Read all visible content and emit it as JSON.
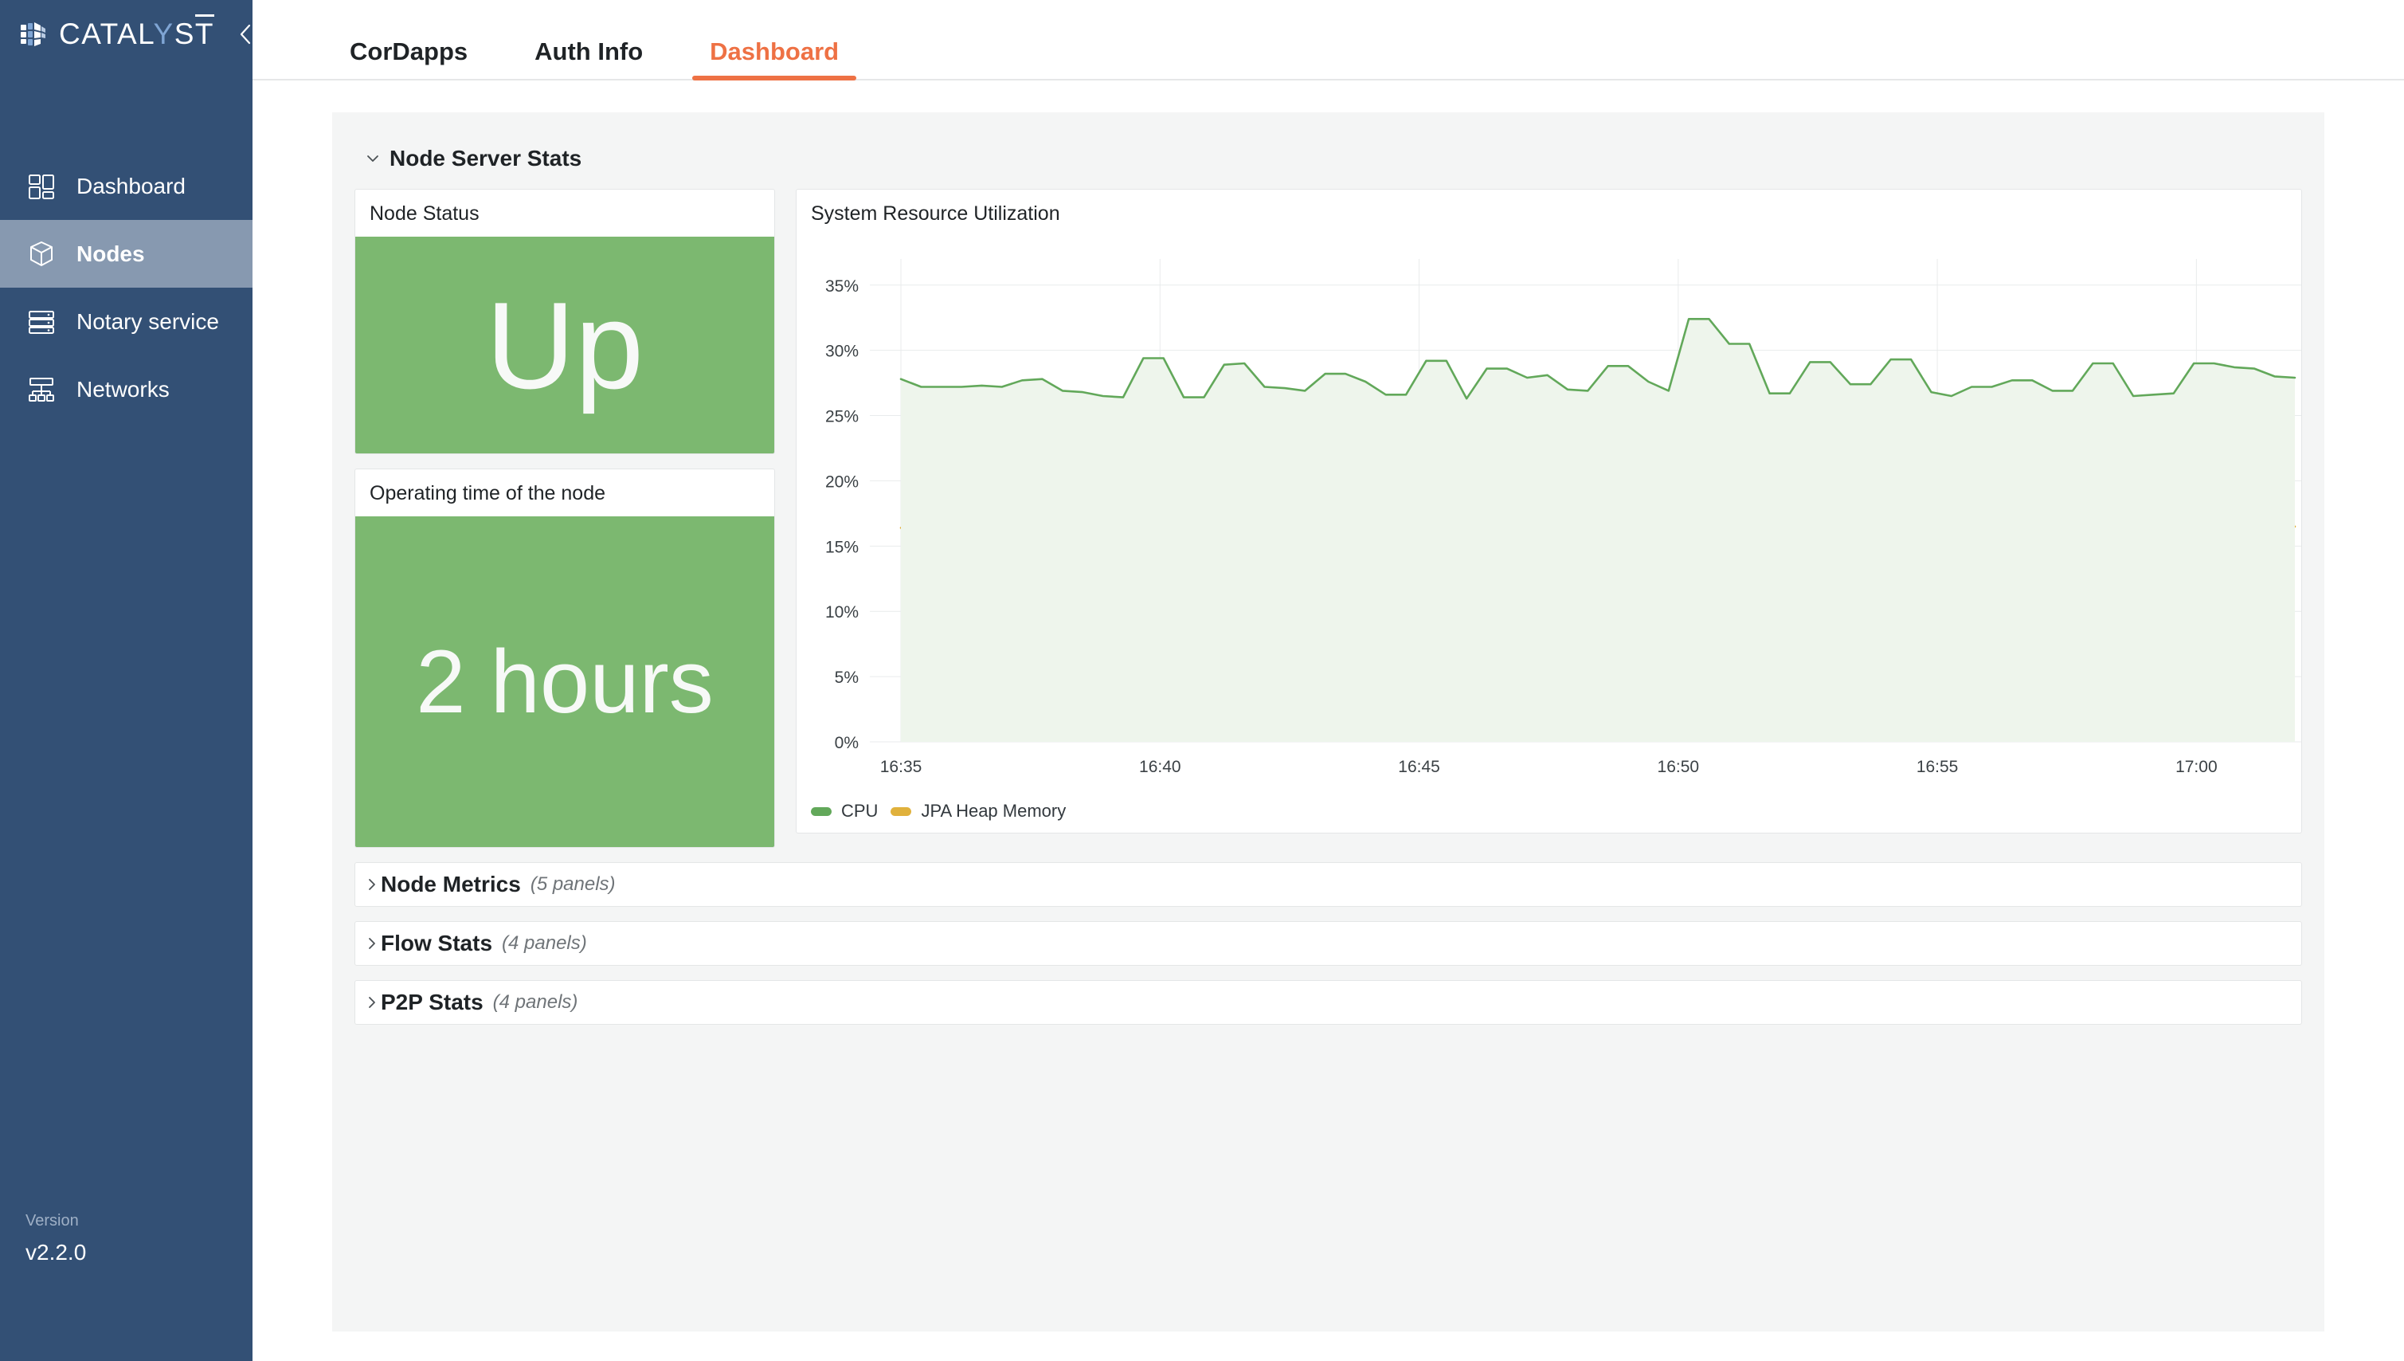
{
  "sidebar": {
    "brand": {
      "name_part1": "CATAL",
      "name_highlight": "Y",
      "name_part2": "S",
      "name_part3": "T",
      "logo_icon": "catalyst-cube-logo-icon"
    },
    "collapse_icon": "chevron-left-icon",
    "items": [
      {
        "label": "Dashboard",
        "icon": "dashboard-grid-icon",
        "active": false
      },
      {
        "label": "Nodes",
        "icon": "cube-icon",
        "active": true
      },
      {
        "label": "Notary service",
        "icon": "server-stack-icon",
        "active": false
      },
      {
        "label": "Networks",
        "icon": "network-tree-icon",
        "active": false
      }
    ],
    "version_label": "Version",
    "version_value": "v2.2.0",
    "background_color": "#335075",
    "active_color": "#8799b0"
  },
  "tabs": [
    {
      "label": "CorDapps",
      "active": false
    },
    {
      "label": "Auth Info",
      "active": false
    },
    {
      "label": "Dashboard",
      "active": true
    }
  ],
  "accent_color": "#ee7144",
  "sections": [
    {
      "title": "Node Server Stats",
      "expanded": true,
      "caret": "chevron-down-icon",
      "count": ""
    },
    {
      "title": "Node Metrics",
      "expanded": false,
      "caret": "chevron-right-icon",
      "count": "(5 panels)"
    },
    {
      "title": "Flow Stats",
      "expanded": false,
      "caret": "chevron-right-icon",
      "count": "(4 panels)"
    },
    {
      "title": "P2P Stats",
      "expanded": false,
      "caret": "chevron-right-icon",
      "count": "(4 panels)"
    }
  ],
  "panels": {
    "node_status": {
      "title": "Node Status",
      "value": "Up",
      "color": "#7cb870"
    },
    "operating_time": {
      "title": "Operating time of the node",
      "value": "2 hours",
      "color": "#7cb870"
    },
    "chart": {
      "title": "System Resource Utilization"
    }
  },
  "chart_data": {
    "type": "line",
    "title": "System Resource Utilization",
    "xlabel": "",
    "ylabel": "",
    "grid": true,
    "legend_position": "bottom-left",
    "ylim": [
      0,
      37
    ],
    "yticks": [
      "0%",
      "5%",
      "10%",
      "15%",
      "20%",
      "25%",
      "30%",
      "35%"
    ],
    "ytick_values": [
      0,
      5,
      10,
      15,
      20,
      25,
      30,
      35
    ],
    "xticks": [
      "16:35",
      "16:40",
      "16:45",
      "16:50",
      "16:55",
      "17:00"
    ],
    "xtick_values": [
      0,
      5,
      10,
      15,
      20,
      25
    ],
    "xlim": [
      -0.6,
      27.5
    ],
    "series": [
      {
        "name": "CPU",
        "color": "#62a85a",
        "fill": "#eef5ec",
        "values": [
          27.8,
          27.2,
          27.2,
          27.2,
          27.3,
          27.2,
          27.7,
          27.8,
          26.9,
          26.8,
          26.5,
          26.4,
          29.4,
          29.4,
          26.4,
          26.4,
          28.9,
          29.0,
          27.2,
          27.1,
          26.9,
          28.2,
          28.2,
          27.6,
          26.6,
          26.6,
          29.2,
          29.2,
          26.3,
          28.6,
          28.6,
          27.9,
          28.1,
          27.0,
          26.9,
          28.8,
          28.8,
          27.6,
          26.9,
          32.4,
          32.4,
          30.5,
          30.5,
          26.7,
          26.7,
          29.1,
          29.1,
          27.4,
          27.4,
          29.3,
          29.3,
          26.8,
          26.5,
          27.2,
          27.2,
          27.7,
          27.7,
          26.9,
          26.9,
          29.0,
          29.0,
          26.5,
          26.6,
          26.7,
          29.0,
          29.0,
          28.7,
          28.6,
          28.0,
          27.9
        ]
      },
      {
        "name": "JPA Heap Memory",
        "color": "#e0b13c",
        "fill": "#fbf8ee",
        "values": [
          16.4,
          16.4,
          16.4,
          16.4,
          16.4,
          16.4,
          16.4,
          16.4,
          16.4,
          16.3,
          16.3,
          16.3,
          16.3,
          16.4,
          16.5,
          16.5,
          16.5,
          16.5,
          16.5,
          16.4,
          16.4,
          16.4,
          16.4,
          16.4,
          16.4,
          16.3,
          16.3,
          16.3,
          16.3,
          16.4,
          16.4,
          16.4,
          16.4,
          16.4,
          16.4,
          16.4,
          16.4,
          16.3,
          16.3,
          16.3,
          16.3,
          16.4,
          16.4,
          16.4,
          16.4,
          16.4,
          16.5,
          16.6,
          16.7,
          16.7,
          16.7,
          16.7,
          16.7,
          16.7,
          16.8,
          16.8,
          16.8,
          16.8,
          16.8,
          16.8,
          16.6,
          16.5,
          16.5,
          16.5,
          16.5,
          16.5,
          16.5,
          16.5,
          16.5,
          16.5
        ]
      }
    ]
  }
}
